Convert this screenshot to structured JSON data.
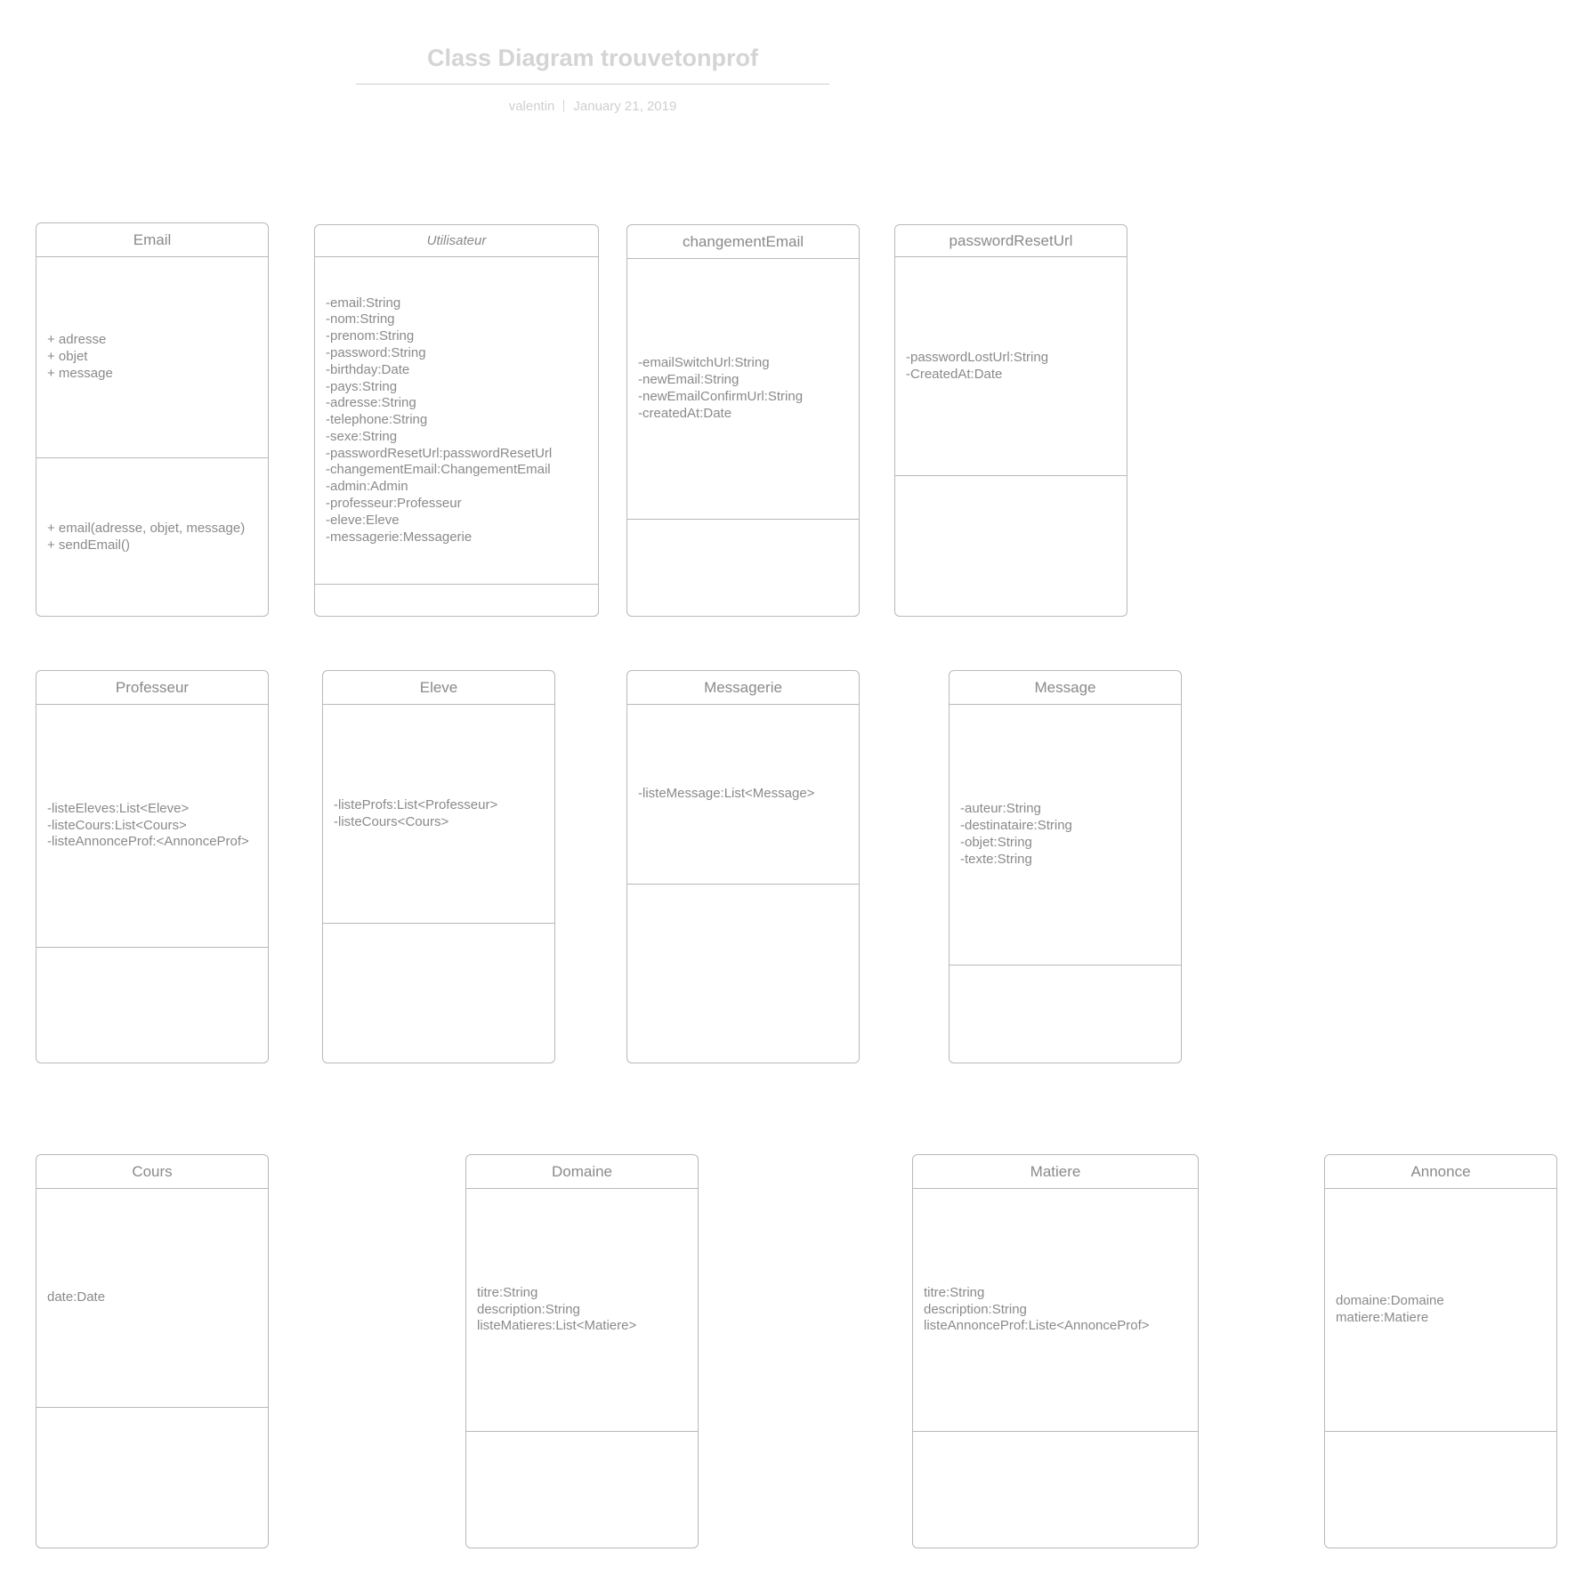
{
  "header": {
    "title": "Class Diagram trouvetonprof",
    "author": "valentin",
    "date": "January 21, 2019"
  },
  "classes": [
    {
      "id": "email",
      "name": "Email",
      "abstract": false,
      "attributes": [
        "+ adresse",
        "+ objet",
        "+ message"
      ],
      "methods": [
        "+ email(adresse, objet, message)",
        "+ sendEmail()"
      ]
    },
    {
      "id": "utilisateur",
      "name": "Utilisateur",
      "abstract": true,
      "attributes": [
        "-email:String",
        "-nom:String",
        "-prenom:String",
        "-password:String",
        "-birthday:Date",
        "-pays:String",
        "-adresse:String",
        "-telephone:String",
        "-sexe:String",
        "-passwordResetUrl:passwordResetUrl",
        "-changementEmail:ChangementEmail",
        "-admin:Admin",
        "-professeur:Professeur",
        "-eleve:Eleve",
        "-messagerie:Messagerie"
      ],
      "methods": []
    },
    {
      "id": "changement-email",
      "name": "changementEmail",
      "abstract": false,
      "attributes": [
        "-emailSwitchUrl:String",
        "-newEmail:String",
        "-newEmailConfirmUrl:String",
        "-createdAt:Date"
      ],
      "methods": []
    },
    {
      "id": "password-reset-url",
      "name": "passwordResetUrl",
      "abstract": false,
      "attributes": [
        "-passwordLostUrl:String",
        "-CreatedAt:Date"
      ],
      "methods": []
    },
    {
      "id": "professeur",
      "name": "Professeur",
      "abstract": false,
      "attributes": [
        "-listeEleves:List<Eleve>",
        "-listeCours:List<Cours>",
        "-listeAnnonceProf:<AnnonceProf>"
      ],
      "methods": []
    },
    {
      "id": "eleve",
      "name": "Eleve",
      "abstract": false,
      "attributes": [
        "-listeProfs:List<Professeur>",
        "-listeCours<Cours>"
      ],
      "methods": []
    },
    {
      "id": "messagerie",
      "name": "Messagerie",
      "abstract": false,
      "attributes": [
        "-listeMessage:List<Message>"
      ],
      "methods": []
    },
    {
      "id": "message",
      "name": "Message",
      "abstract": false,
      "attributes": [
        "-auteur:String",
        "-destinataire:String",
        "-objet:String",
        "-texte:String"
      ],
      "methods": []
    },
    {
      "id": "cours",
      "name": "Cours",
      "abstract": false,
      "attributes": [
        "date:Date"
      ],
      "methods": []
    },
    {
      "id": "domaine",
      "name": "Domaine",
      "abstract": false,
      "attributes": [
        "titre:String",
        "description:String",
        "listeMatieres:List<Matiere>"
      ],
      "methods": []
    },
    {
      "id": "matiere",
      "name": "Matiere",
      "abstract": false,
      "attributes": [
        "titre:String",
        "description:String",
        "listeAnnonceProf:Liste<AnnonceProf>"
      ],
      "methods": []
    },
    {
      "id": "annonce",
      "name": "Annonce",
      "abstract": false,
      "attributes": [
        "domaine:Domaine",
        "matiere:Matiere"
      ],
      "methods": []
    }
  ]
}
